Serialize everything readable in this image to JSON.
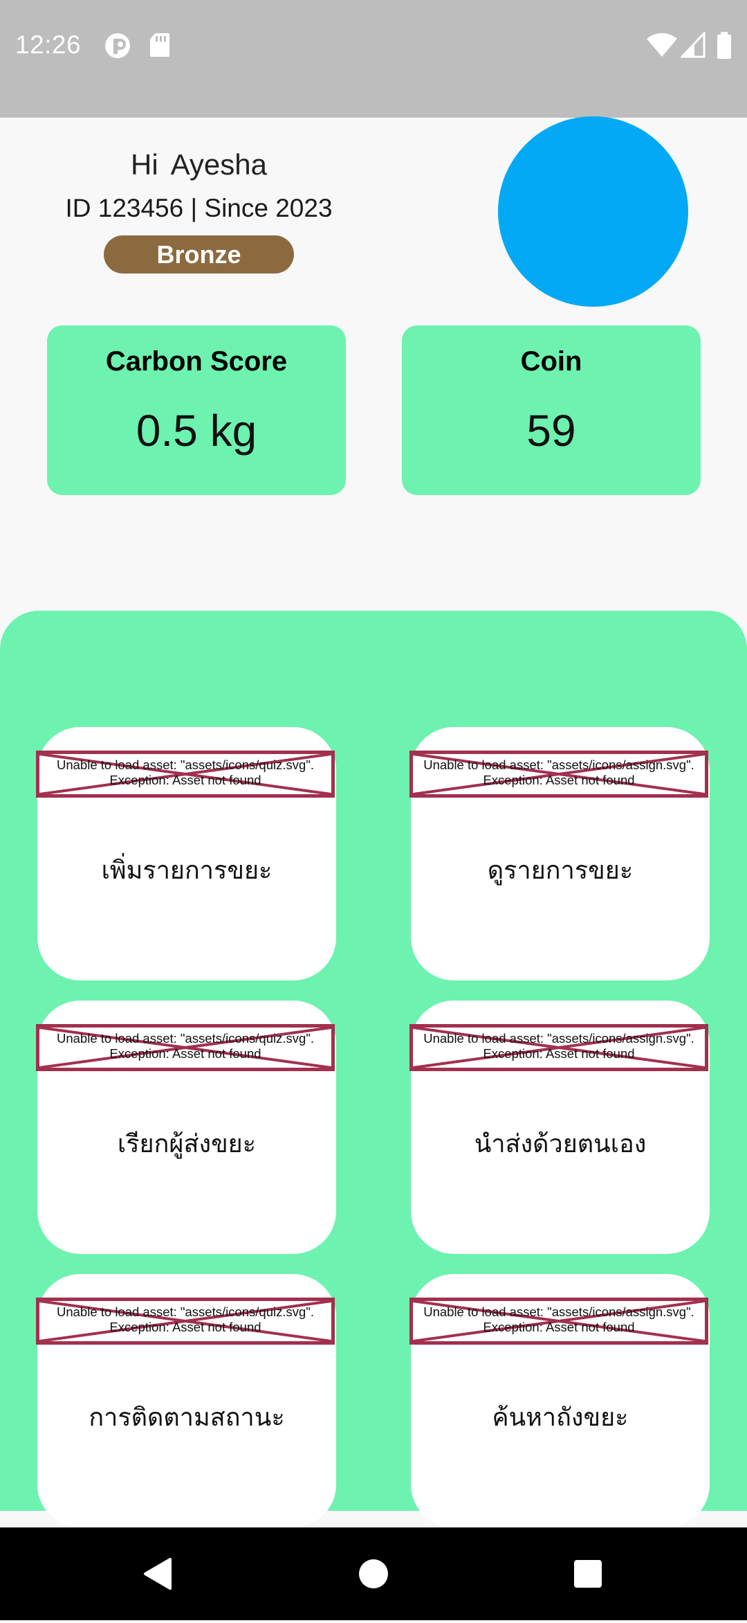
{
  "status_bar": {
    "time": "12:26",
    "icons": [
      "notification-app-icon",
      "sd-card-icon",
      "wifi-icon",
      "cell-signal-icon",
      "battery-icon"
    ]
  },
  "profile": {
    "greeting": "Hi",
    "name": "Ayesha",
    "member_line": "ID 123456 | Since 2023",
    "tier": "Bronze",
    "tier_color": "#8c6a40",
    "avatar_color": "#03a9f4"
  },
  "stats": [
    {
      "label": "Carbon Score",
      "value": "0.5 kg"
    },
    {
      "label": "Coin",
      "value": "59"
    }
  ],
  "menu": {
    "accent_color": "#6df2b0",
    "tiles": [
      {
        "label": "เพิ่มรายการขยะ",
        "error_line1": "Unable to load asset: \"assets/icons/quiz.svg\".",
        "error_line2": "Exception: Asset not found"
      },
      {
        "label": "ดูรายการขยะ",
        "error_line1": "Unable to load asset: \"assets/icons/assign.svg\".",
        "error_line2": "Exception: Asset not found"
      },
      {
        "label": "เรียกผู้ส่งขยะ",
        "error_line1": "Unable to load asset: \"assets/icons/quiz.svg\".",
        "error_line2": "Exception: Asset not found"
      },
      {
        "label": "นำส่งด้วยตนเอง",
        "error_line1": "Unable to load asset: \"assets/icons/assign.svg\".",
        "error_line2": "Exception: Asset not found"
      },
      {
        "label": "การติดตามสถานะ",
        "error_line1": "Unable to load asset: \"assets/icons/quiz.svg\".",
        "error_line2": "Exception: Asset not found"
      },
      {
        "label": "ค้นหาถังขยะ",
        "error_line1": "Unable to load asset: \"assets/icons/assign.svg\".",
        "error_line2": "Exception: Asset not found"
      }
    ]
  },
  "nav": [
    "back-icon",
    "home-icon",
    "recents-icon"
  ]
}
